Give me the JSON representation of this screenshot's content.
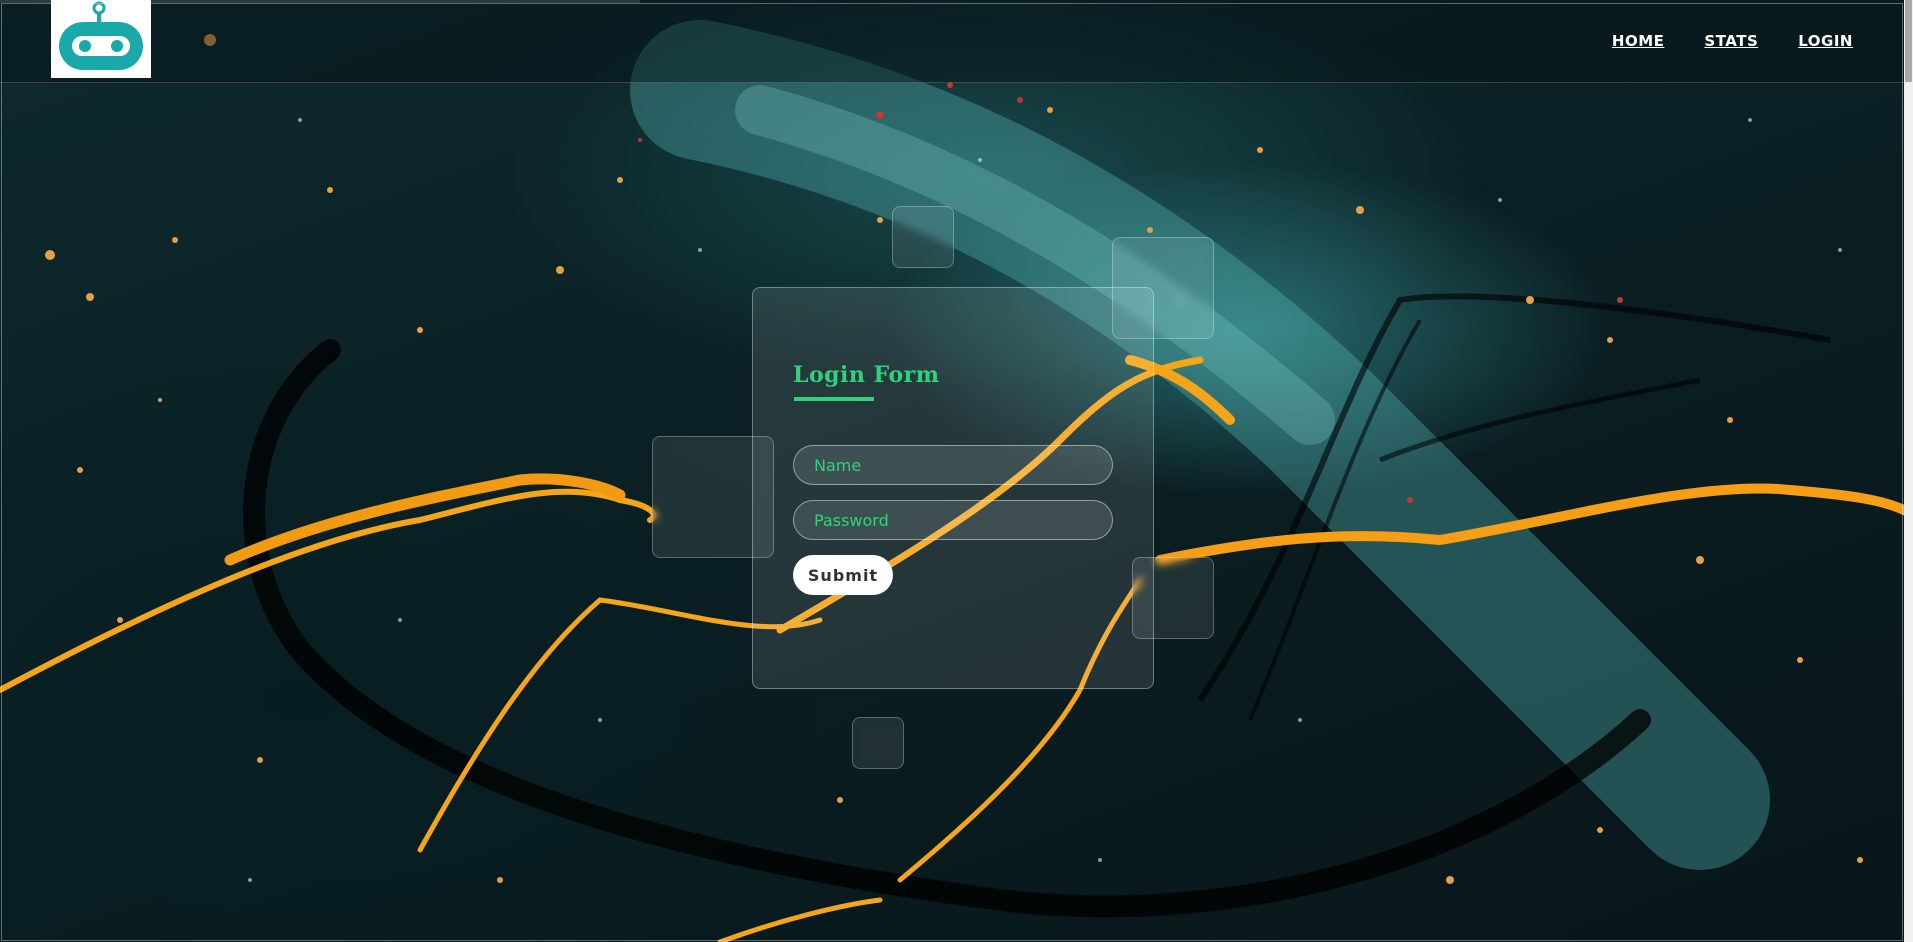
{
  "navbar": {
    "logo_icon": "robot-head-icon",
    "links": [
      {
        "label": "HOME"
      },
      {
        "label": "STATS"
      },
      {
        "label": "LOGIN"
      }
    ]
  },
  "login_form": {
    "title": "Login Form",
    "name_placeholder": "Name",
    "password_placeholder": "Password",
    "submit_label": "Submit"
  },
  "colors": {
    "accent": "#2fd37a",
    "logo": "#1aa9a9",
    "background": "#0b2226",
    "paint_orange": "#f5a51a"
  }
}
